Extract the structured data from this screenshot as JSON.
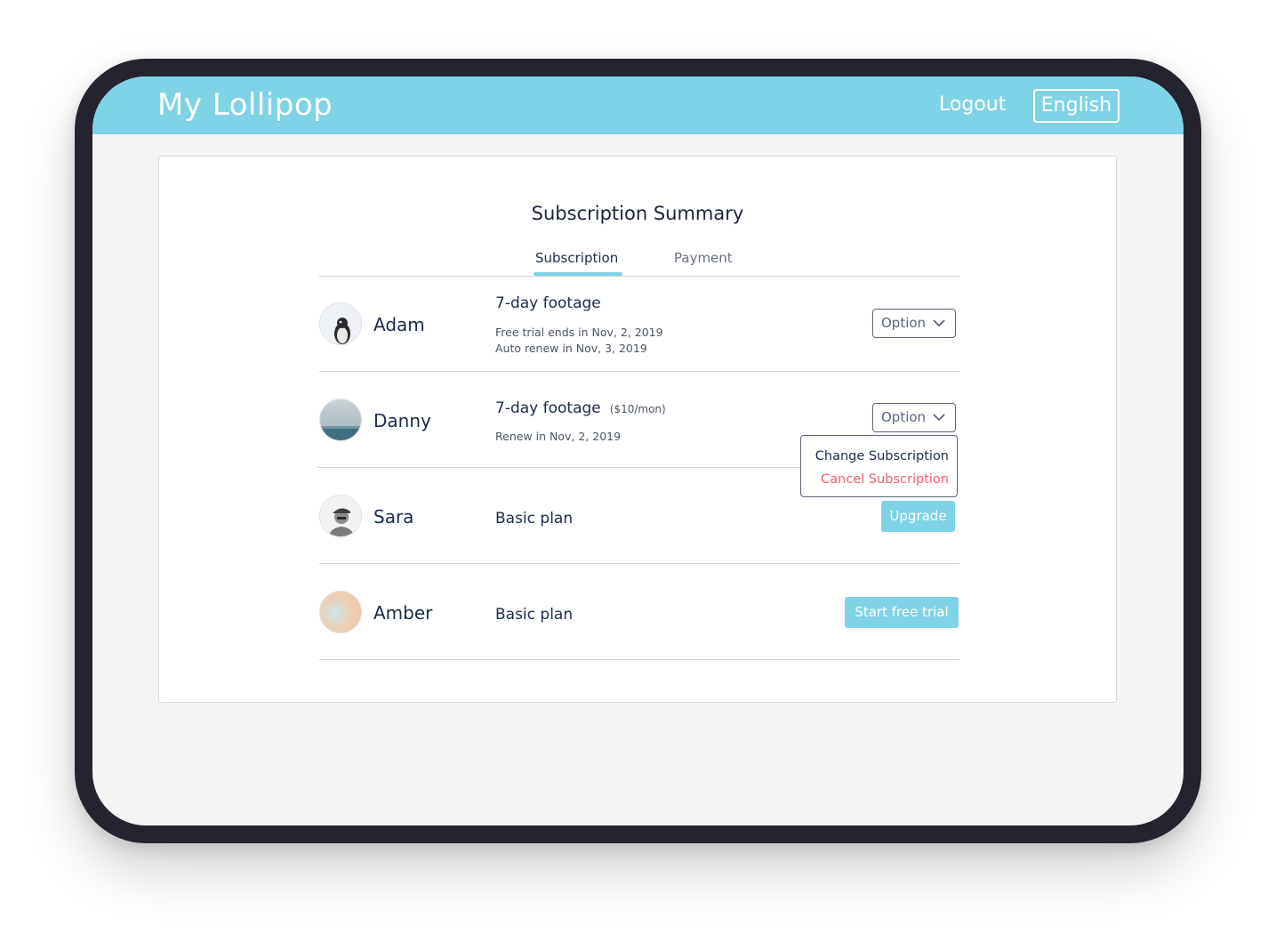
{
  "header": {
    "brand": "My Lollipop",
    "logout_label": "Logout",
    "language_label": "English",
    "accent_color": "#7fd3e6"
  },
  "card": {
    "title": "Subscription Summary",
    "tabs": [
      {
        "label": "Subscription",
        "active": true
      },
      {
        "label": "Payment",
        "active": false
      }
    ]
  },
  "rows": [
    {
      "name": "Adam",
      "avatar": "penguin-avatar",
      "plan": "7-day footage",
      "meta": [
        "Free trial ends in Nov, 2, 2019",
        "Auto renew in Nov, 3, 2019"
      ],
      "action": "Option"
    },
    {
      "name": "Danny",
      "avatar": "sea-avatar",
      "plan": "7-day footage",
      "price": "($10/mon)",
      "meta": [
        "Renew in Nov, 2, 2019"
      ],
      "action": "Option",
      "dropdown": [
        "Change Subscription",
        "Cancel Subscription"
      ]
    },
    {
      "name": "Sara",
      "avatar": "person-avatar",
      "plan": "Basic plan",
      "action": "Upgrade"
    },
    {
      "name": "Amber",
      "avatar": "blurred-avatar",
      "plan": "Basic plan",
      "action": "Start free trial"
    }
  ],
  "colors": {
    "cancel_text": "#f0606a",
    "frame": "#23242f",
    "text_dark": "#1b2b4a"
  }
}
